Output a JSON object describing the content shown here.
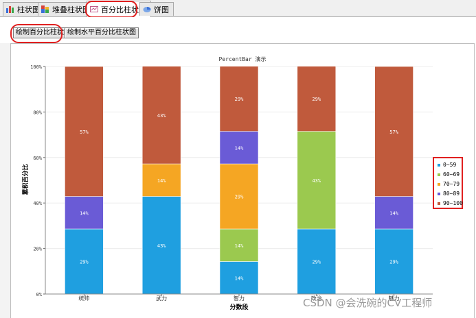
{
  "tabs": [
    {
      "label": "柱状图",
      "icon": "bar-chart-icon",
      "active": false
    },
    {
      "label": "堆叠柱状图",
      "icon": "stacked-bar-icon",
      "active": false
    },
    {
      "label": "百分比柱状图",
      "icon": "percent-bar-icon",
      "active": true
    },
    {
      "label": "饼图",
      "icon": "pie-chart-icon",
      "active": false
    }
  ],
  "buttons": {
    "draw_percent": "绘制百分比柱状图",
    "draw_horizontal": "绘制水平百分比柱状图"
  },
  "watermark": "CSDN @会洗碗的CV工程师",
  "colors": {
    "s0": "#1f9fe0",
    "s1": "#9bc94f",
    "s2": "#f5a623",
    "s3": "#6a5bd6",
    "s4": "#c05a3c",
    "annotation": "#e02020"
  },
  "chart_data": {
    "type": "bar",
    "stacked": true,
    "percent": true,
    "title": "PercentBar 演示",
    "xlabel": "分数段",
    "ylabel": "累积百分比",
    "categories": [
      "统帅",
      "武力",
      "智力",
      "政治",
      "魅力"
    ],
    "ylim": [
      0,
      100
    ],
    "yticks": [
      "0%",
      "20%",
      "40%",
      "60%",
      "80%",
      "100%"
    ],
    "grid": true,
    "legend_position": "right",
    "series": [
      {
        "name": "0~59",
        "values": [
          28.6,
          42.9,
          14.3,
          28.6,
          28.6
        ],
        "labels": [
          "29%",
          "43%",
          "14%",
          "29%",
          "29%"
        ]
      },
      {
        "name": "60~69",
        "values": [
          0,
          0,
          14.3,
          42.9,
          0
        ],
        "labels": [
          "",
          "",
          "14%",
          "43%",
          ""
        ]
      },
      {
        "name": "70~79",
        "values": [
          0,
          14.3,
          28.6,
          0,
          0
        ],
        "labels": [
          "",
          "14%",
          "29%",
          "",
          ""
        ]
      },
      {
        "name": "80~89",
        "values": [
          14.3,
          0,
          14.3,
          0,
          14.3
        ],
        "labels": [
          "14%",
          "",
          "14%",
          "",
          "14%"
        ]
      },
      {
        "name": "90~100",
        "values": [
          57.1,
          42.9,
          28.6,
          28.6,
          57.1
        ],
        "labels": [
          "57%",
          "43%",
          "29%",
          "29%",
          "57%"
        ]
      }
    ]
  }
}
